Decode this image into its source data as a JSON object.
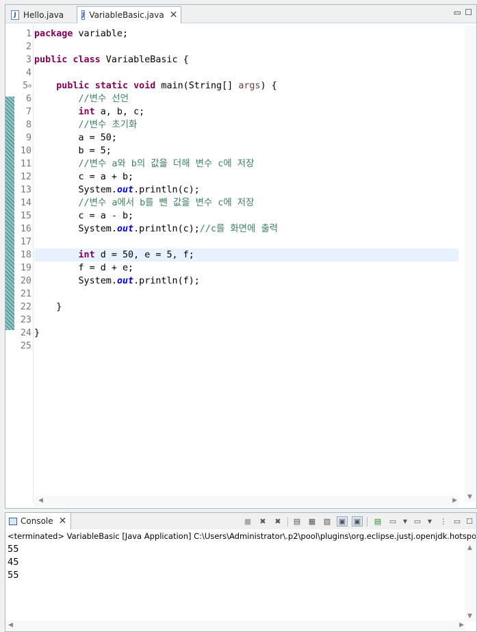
{
  "editor": {
    "tabs": [
      {
        "label": "Hello.java",
        "icon": "java-file-icon"
      },
      {
        "label": "VariableBasic.java",
        "icon": "java-file-icon",
        "active": true
      }
    ]
  },
  "code_lines": [
    {
      "n": "1",
      "html": "<span class='kw'>package</span> variable;"
    },
    {
      "n": "2",
      "html": ""
    },
    {
      "n": "3",
      "html": "<span class='kw'>public</span> <span class='kw'>class</span> VariableBasic {"
    },
    {
      "n": "4",
      "html": ""
    },
    {
      "n": "5",
      "html": "    <span class='kw'>public</span> <span class='kw'>static</span> <span class='kw'>void</span> main(String[] <span class='param'>args</span>) {",
      "fold": true
    },
    {
      "n": "6",
      "html": "        <span class='cm'>//변수 선언</span>"
    },
    {
      "n": "7",
      "html": "        <span class='kw'>int</span> a, b, c;"
    },
    {
      "n": "8",
      "html": "        <span class='cm'>//변수 초기화</span>"
    },
    {
      "n": "9",
      "html": "        a = 50;"
    },
    {
      "n": "10",
      "html": "        b = 5;"
    },
    {
      "n": "11",
      "html": "        <span class='cm'>//변수 a와 b의 값을 더해 변수 c에 저장</span>"
    },
    {
      "n": "12",
      "html": "        c = a + b;"
    },
    {
      "n": "13",
      "html": "        System.<span class='fld'>out</span>.println(c);"
    },
    {
      "n": "14",
      "html": "        <span class='cm'>//변수 a에서 b를 뺀 값을 변수 c에 저장</span>"
    },
    {
      "n": "15",
      "html": "        c = a - b;"
    },
    {
      "n": "16",
      "html": "        System.<span class='fld'>out</span>.println(c);<span class='cm'>//c를 화면에 출력</span>"
    },
    {
      "n": "17",
      "html": ""
    },
    {
      "n": "18",
      "html": "        <span class='kw'>int</span> d = 50, e = 5, f;",
      "current": true
    },
    {
      "n": "19",
      "html": "        f = d + e;"
    },
    {
      "n": "20",
      "html": "        System.<span class='fld'>out</span>.println(f);"
    },
    {
      "n": "21",
      "html": ""
    },
    {
      "n": "22",
      "html": "    }"
    },
    {
      "n": "23",
      "html": ""
    },
    {
      "n": "24",
      "html": "}"
    },
    {
      "n": "25",
      "html": ""
    }
  ],
  "console": {
    "tab_label": "Console",
    "status": "<terminated> VariableBasic [Java Application] C:\\Users\\Administrator\\.p2\\pool\\plugins\\org.eclipse.justj.openjdk.hotspot.jre.",
    "output": [
      "55",
      "45",
      "55"
    ]
  }
}
